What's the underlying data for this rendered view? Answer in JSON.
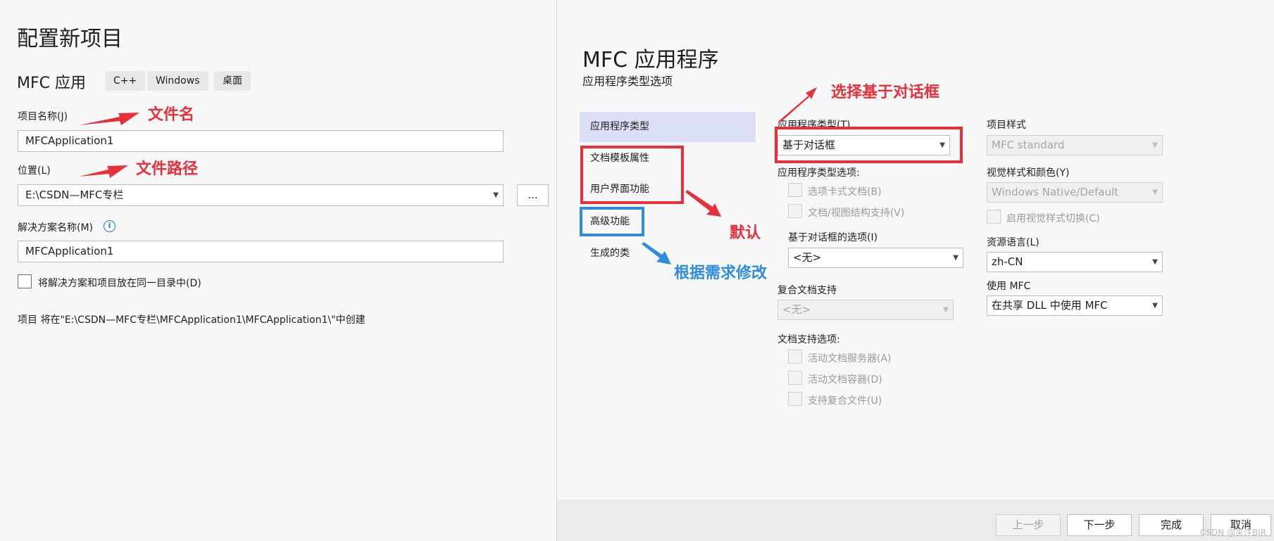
{
  "left": {
    "title": "配置新项目",
    "project_type": "MFC 应用",
    "tags": [
      "C++",
      "Windows",
      "桌面"
    ],
    "project_name_label": "项目名称(J)",
    "project_name_value": "MFCApplication1",
    "location_label": "位置(L)",
    "location_value": "E:\\CSDN—MFC专栏",
    "browse_label": "...",
    "solution_name_label": "解决方案名称(M)",
    "info_icon": "i",
    "solution_name_value": "MFCApplication1",
    "same_dir_label": "将解决方案和项目放在同一目录中(D)",
    "create_path_text": "项目 将在\"E:\\CSDN—MFC专栏\\MFCApplication1\\MFCApplication1\\\"中创建"
  },
  "right": {
    "title": "MFC 应用程序",
    "subtitle": "应用程序类型选项",
    "nav": [
      {
        "label": "应用程序类型",
        "active": true
      },
      {
        "label": "文档模板属性",
        "active": false
      },
      {
        "label": "用户界面功能",
        "active": false
      },
      {
        "label": "高级功能",
        "active": false
      },
      {
        "label": "生成的类",
        "active": false
      }
    ],
    "app_type_label": "应用程序类型(T)",
    "app_type_value": "基于对话框",
    "app_type_options_label": "应用程序类型选项:",
    "tabbed_docs_label": "选项卡式文档(B)",
    "doc_view_label": "文档/视图结构支持(V)",
    "dialog_options_label": "基于对话框的选项(I)",
    "dialog_options_value": "<无>",
    "compound_doc_label": "复合文档支持",
    "compound_doc_value": "<无>",
    "doc_support_label": "文档支持选项:",
    "doc_support_options": [
      "活动文档服务器(A)",
      "活动文档容器(D)",
      "支持复合文件(U)"
    ],
    "project_style_label": "项目样式",
    "project_style_value": "MFC standard",
    "visual_style_label": "视觉样式和颜色(Y)",
    "visual_style_value": "Windows Native/Default",
    "enable_visual_switch_label": "启用视觉样式切换(C)",
    "resource_lang_label": "资源语言(L)",
    "resource_lang_value": "zh-CN",
    "use_mfc_label": "使用 MFC",
    "use_mfc_value": "在共享 DLL 中使用 MFC"
  },
  "buttons": {
    "prev": "上一步",
    "next": "下一步",
    "finish": "完成",
    "cancel": "取消"
  },
  "annotations": {
    "filename": "文件名",
    "filepath": "文件路径",
    "choose_dialog": "选择基于对话框",
    "default": "默认",
    "modify": "根据需求修改"
  },
  "watermark": "CSDN @关注BIR",
  "colors": {
    "annotation_red": "#e8303a",
    "annotation_blue": "#2f8de0",
    "nav_active": "#dadff7",
    "info_icon": "#1a7fd0"
  }
}
